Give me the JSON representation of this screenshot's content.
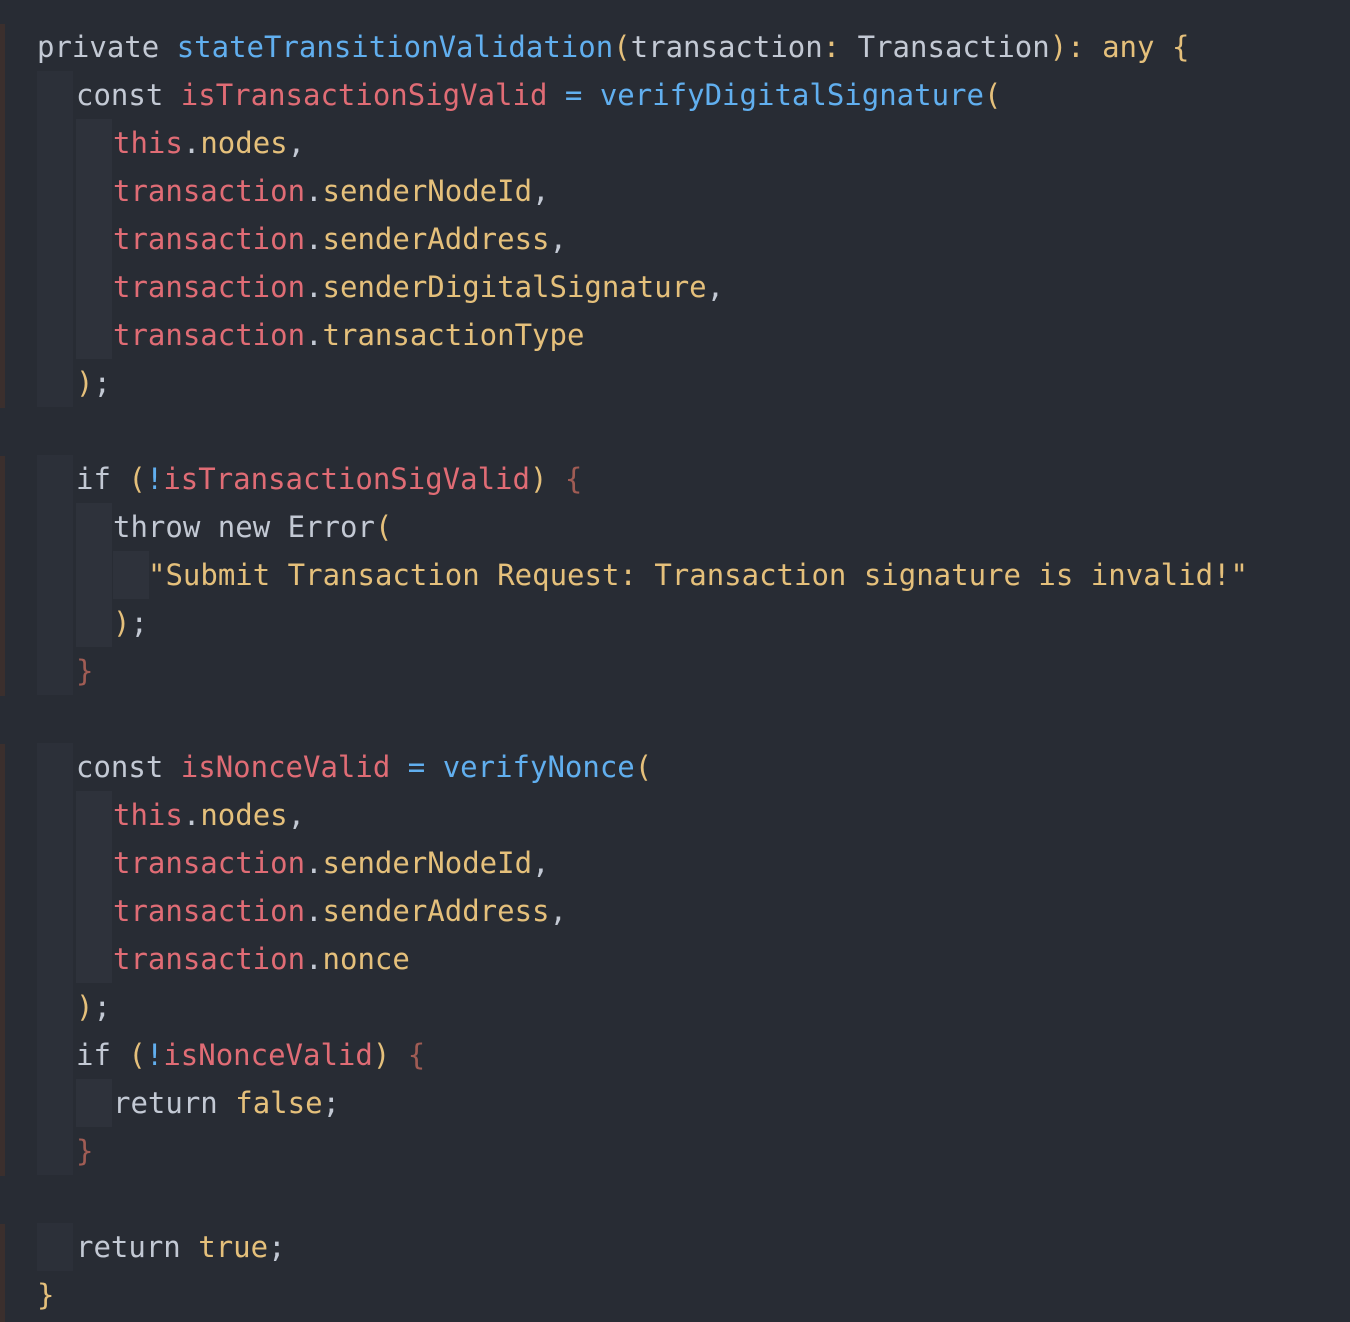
{
  "colors": {
    "background": "#282c34",
    "keyword": "#c3c9d4",
    "function": "#61afef",
    "variable": "#e06c75",
    "property": "#e5c07b",
    "brace_dim": "#a05c54",
    "gutter_marker": "#3b2f2d"
  },
  "code": {
    "l1": {
      "kw": "private",
      "fn": "stateTransitionValidation",
      "p1": "(",
      "param": "transaction",
      "colon": ": ",
      "type": "Transaction",
      "p2": ")",
      "colon2": ": ",
      "ret": "any",
      "brace": "{"
    },
    "l2": {
      "kw": "const",
      "var": "isTransactionSigValid",
      "op": "=",
      "fn": "verifyDigitalSignature",
      "p": "("
    },
    "l3": {
      "obj": "this",
      "dot": ".",
      "prop": "nodes",
      "comma": ","
    },
    "l4": {
      "obj": "transaction",
      "dot": ".",
      "prop": "senderNodeId",
      "comma": ","
    },
    "l5": {
      "obj": "transaction",
      "dot": ".",
      "prop": "senderAddress",
      "comma": ","
    },
    "l6": {
      "obj": "transaction",
      "dot": ".",
      "prop": "senderDigitalSignature",
      "comma": ","
    },
    "l7": {
      "obj": "transaction",
      "dot": ".",
      "prop": "transactionType"
    },
    "l8": {
      "p": ")",
      "semi": ";"
    },
    "l10": {
      "kw": "if",
      "p1": "(",
      "not": "!",
      "var": "isTransactionSigValid",
      "p2": ")",
      "brace": "{"
    },
    "l11": {
      "kw1": "throw",
      "kw2": "new",
      "cls": "Error",
      "p": "("
    },
    "l12": {
      "str": "\"Submit Transaction Request: Transaction signature is invalid!\""
    },
    "l13": {
      "p": ")",
      "semi": ";"
    },
    "l14": {
      "brace": "}"
    },
    "l16": {
      "kw": "const",
      "var": "isNonceValid",
      "op": "=",
      "fn": "verifyNonce",
      "p": "("
    },
    "l17": {
      "obj": "this",
      "dot": ".",
      "prop": "nodes",
      "comma": ","
    },
    "l18": {
      "obj": "transaction",
      "dot": ".",
      "prop": "senderNodeId",
      "comma": ","
    },
    "l19": {
      "obj": "transaction",
      "dot": ".",
      "prop": "senderAddress",
      "comma": ","
    },
    "l20": {
      "obj": "transaction",
      "dot": ".",
      "prop": "nonce"
    },
    "l21": {
      "p": ")",
      "semi": ";"
    },
    "l22": {
      "kw": "if",
      "p1": "(",
      "not": "!",
      "var": "isNonceValid",
      "p2": ")",
      "brace": "{"
    },
    "l23": {
      "kw": "return",
      "val": "false",
      "semi": ";"
    },
    "l24": {
      "brace": "}"
    },
    "l26": {
      "kw": "return",
      "val": "true",
      "semi": ";"
    },
    "l27": {
      "brace": "}"
    }
  }
}
